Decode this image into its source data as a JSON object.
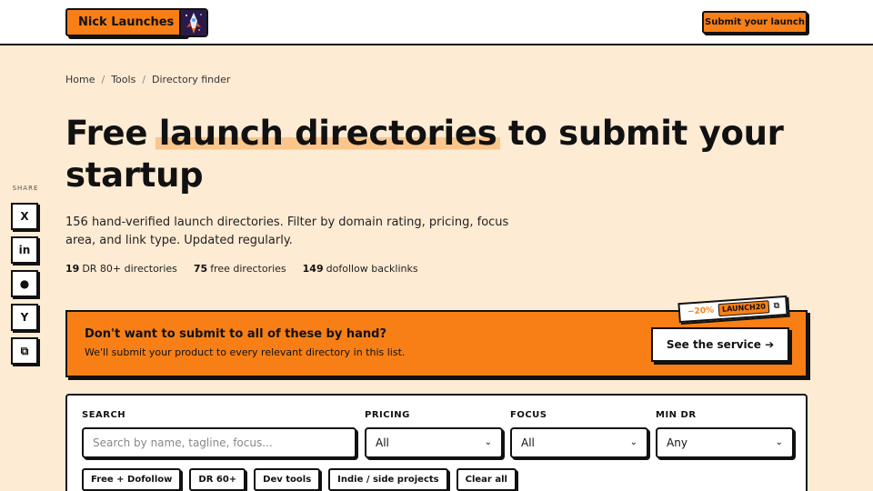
{
  "header": {
    "brand_label": "Nick Launches",
    "logo_icon": "rocket-logo-icon",
    "submit_label": "Submit your launch",
    "accent_color": "#f77f16"
  },
  "breadcrumb": {
    "items": [
      "Home",
      "Tools",
      "Directory finder"
    ],
    "separator": "/"
  },
  "hero": {
    "title_before": "Free ",
    "title_highlight": "launch directories",
    "title_after": " to submit your startup",
    "lede": "156 hand-verified launch directories. Filter by domain rating, pricing, focus area, and link type. Updated regularly."
  },
  "stats": [
    {
      "num": "19",
      "text": "DR 80+ directories"
    },
    {
      "num": "75",
      "text": "free directories"
    },
    {
      "num": "149",
      "text": "dofollow backlinks"
    }
  ],
  "share": {
    "label": "SHARE",
    "buttons": [
      {
        "icon": "x-twitter-icon",
        "glyph": "X"
      },
      {
        "icon": "linkedin-icon",
        "glyph": "in"
      },
      {
        "icon": "reddit-icon",
        "glyph": "●"
      },
      {
        "icon": "hacker-news-icon",
        "glyph": "Y"
      },
      {
        "icon": "copy-icon",
        "glyph": "⧉"
      }
    ]
  },
  "promo": {
    "title": "Don't want to submit to all of these by hand?",
    "subtitle": "We'll submit your product to every relevant directory in this list.",
    "cta": "See the service ➔",
    "coupon_off": "−20%",
    "coupon_code": "LAUNCH20",
    "coupon_copy_icon": "copy-icon"
  },
  "filters": {
    "search_label": "SEARCH",
    "search_placeholder": "Search by name, tagline, focus...",
    "pricing_label": "PRICING",
    "pricing_value": "All",
    "focus_label": "FOCUS",
    "focus_value": "All",
    "mindr_label": "MIN DR",
    "mindr_value": "Any",
    "chips": [
      "Free + Dofollow",
      "DR 60+",
      "Dev tools",
      "Indie / side projects",
      "Clear all"
    ]
  }
}
